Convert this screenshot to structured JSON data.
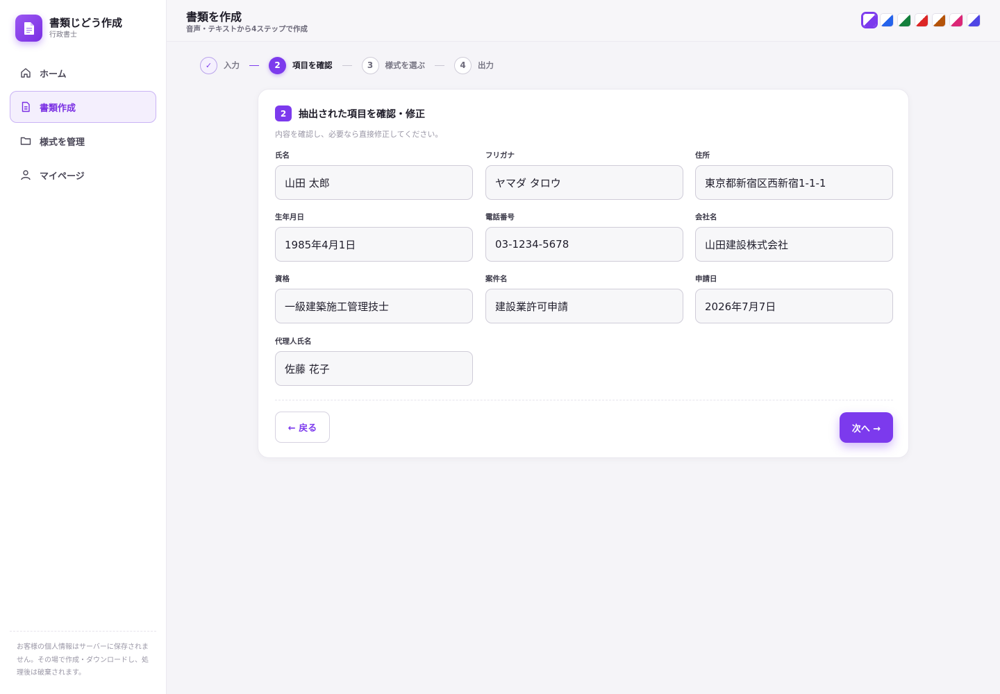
{
  "brand": {
    "title": "書類じどう作成",
    "subtitle": "行政書士"
  },
  "sidebar": {
    "items": [
      {
        "label": "ホーム",
        "icon": "home-icon",
        "active": false
      },
      {
        "label": "書類作成",
        "icon": "document-icon",
        "active": true
      },
      {
        "label": "様式を管理",
        "icon": "folder-icon",
        "active": false
      },
      {
        "label": "マイページ",
        "icon": "user-icon",
        "active": false
      }
    ],
    "note": "お客様の個人情報はサーバーに保存されません。その場で作成・ダウンロードし、処理後は破棄されます。"
  },
  "header": {
    "title": "書類を作成",
    "subtitle": "音声・テキストから4ステップで作成",
    "themes": [
      {
        "color": "#7c3aed",
        "selected": true
      },
      {
        "color": "#2563eb",
        "selected": false
      },
      {
        "color": "#15803d",
        "selected": false
      },
      {
        "color": "#dc2626",
        "selected": false
      },
      {
        "color": "#b45309",
        "selected": false
      },
      {
        "color": "#db2777",
        "selected": false
      },
      {
        "color": "#4f46e5",
        "selected": false
      }
    ]
  },
  "stepper": {
    "steps": [
      {
        "marker": "✓",
        "label": "入力",
        "state": "done"
      },
      {
        "marker": "2",
        "label": "項目を確認",
        "state": "current"
      },
      {
        "marker": "3",
        "label": "様式を選ぶ",
        "state": "todo"
      },
      {
        "marker": "4",
        "label": "出力",
        "state": "todo"
      }
    ],
    "separator": "—"
  },
  "card": {
    "badge": "2",
    "title": "抽出された項目を確認・修正",
    "description": "内容を確認し、必要なら直接修正してください。",
    "fields": {
      "name": {
        "label": "氏名",
        "value": "山田 太郎"
      },
      "furigana": {
        "label": "フリガナ",
        "value": "ヤマダ タロウ"
      },
      "address": {
        "label": "住所",
        "value": "東京都新宿区西新宿1-1-1"
      },
      "birthdate": {
        "label": "生年月日",
        "value": "1985年4月1日"
      },
      "phone": {
        "label": "電話番号",
        "value": "03-1234-5678"
      },
      "company": {
        "label": "会社名",
        "value": "山田建設株式会社"
      },
      "qualification": {
        "label": "資格",
        "value": "一級建築施工管理技士"
      },
      "case_name": {
        "label": "案件名",
        "value": "建設業許可申請"
      },
      "application_date": {
        "label": "申請日",
        "value": "2026年7月7日"
      },
      "agent_name": {
        "label": "代理人氏名",
        "value": "佐藤 花子"
      }
    },
    "back_label": "← 戻る",
    "next_label": "次へ →"
  }
}
